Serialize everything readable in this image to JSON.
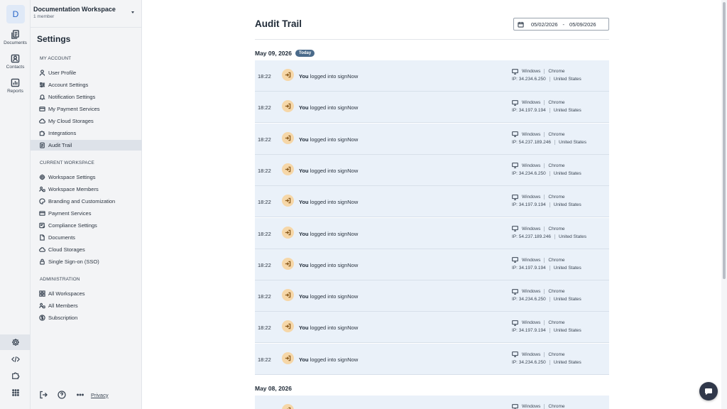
{
  "colors": {
    "accent": "#2a67c9",
    "event_icon_bg": "#f6d7a8",
    "row_bg": "#eaf1f9",
    "badge_bg": "#4a6a8a",
    "chat_button": "#30384a"
  },
  "rail": {
    "avatar_letter": "D",
    "items": [
      {
        "label": "Documents",
        "icon": "documents-icon"
      },
      {
        "label": "Contacts",
        "icon": "contacts-icon"
      },
      {
        "label": "Reports",
        "icon": "reports-icon"
      }
    ],
    "bottom_icons": [
      "gear-icon",
      "code-icon",
      "puzzle-icon",
      "apps-grid-icon"
    ]
  },
  "workspace": {
    "name": "Documentation Workspace",
    "members": "1 member"
  },
  "sidebar": {
    "title": "Settings",
    "my_account": {
      "title": "MY ACCOUNT",
      "items": [
        "User Profile",
        "Account Settings",
        "Notification Settings",
        "My Payment Services",
        "My Cloud Storages",
        "Integrations",
        "Audit Trail"
      ]
    },
    "current_workspace": {
      "title": "CURRENT WORKSPACE",
      "items": [
        "Workspace Settings",
        "Workspace Members",
        "Branding and Customization",
        "Payment Services",
        "Compliance Settings",
        "Documents",
        "Cloud Storages",
        "Single Sign-on (SSO)"
      ]
    },
    "administration": {
      "title": "ADMINISTRATION",
      "items": [
        "All Workspaces",
        "All Members",
        "Subscription"
      ]
    },
    "active_item": "Audit Trail",
    "footer": {
      "privacy": "Privacy"
    }
  },
  "main": {
    "title": "Audit Trail",
    "date_from": "05/02/2026",
    "date_sep": "-",
    "date_to": "05/09/2026",
    "days": [
      {
        "date": "May 09, 2026",
        "badge": "Today",
        "events": [
          {
            "time": "18:22",
            "actor": "You",
            "action": "logged into signNow",
            "os": "Windows",
            "browser": "Chrome",
            "ip": "IP: 34.234.6.250",
            "country": "United States"
          },
          {
            "time": "18:22",
            "actor": "You",
            "action": "logged into signNow",
            "os": "Windows",
            "browser": "Chrome",
            "ip": "IP: 34.197.9.194",
            "country": "United States"
          },
          {
            "time": "18:22",
            "actor": "You",
            "action": "logged into signNow",
            "os": "Windows",
            "browser": "Chrome",
            "ip": "IP: 54.237.189.246",
            "country": "United States"
          },
          {
            "time": "18:22",
            "actor": "You",
            "action": "logged into signNow",
            "os": "Windows",
            "browser": "Chrome",
            "ip": "IP: 34.234.6.250",
            "country": "United States"
          },
          {
            "time": "18:22",
            "actor": "You",
            "action": "logged into signNow",
            "os": "Windows",
            "browser": "Chrome",
            "ip": "IP: 34.197.9.194",
            "country": "United States"
          },
          {
            "time": "18:22",
            "actor": "You",
            "action": "logged into signNow",
            "os": "Windows",
            "browser": "Chrome",
            "ip": "IP: 54.237.189.246",
            "country": "United States"
          },
          {
            "time": "18:22",
            "actor": "You",
            "action": "logged into signNow",
            "os": "Windows",
            "browser": "Chrome",
            "ip": "IP: 34.197.9.194",
            "country": "United States"
          },
          {
            "time": "18:22",
            "actor": "You",
            "action": "logged into signNow",
            "os": "Windows",
            "browser": "Chrome",
            "ip": "IP: 34.234.6.250",
            "country": "United States"
          },
          {
            "time": "18:22",
            "actor": "You",
            "action": "logged into signNow",
            "os": "Windows",
            "browser": "Chrome",
            "ip": "IP: 34.197.9.194",
            "country": "United States"
          },
          {
            "time": "18:22",
            "actor": "You",
            "action": "logged into signNow",
            "os": "Windows",
            "browser": "Chrome",
            "ip": "IP: 34.234.6.250",
            "country": "United States"
          }
        ]
      },
      {
        "date": "May 08, 2026",
        "badge": "",
        "events": [
          {
            "time": "",
            "actor": "",
            "action": "",
            "os": "Windows",
            "browser": "Chrome",
            "ip": "",
            "country": ""
          }
        ]
      }
    ]
  }
}
